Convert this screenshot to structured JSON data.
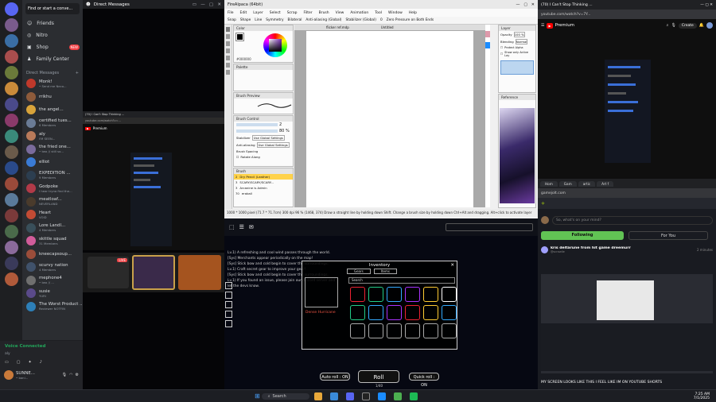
{
  "discord": {
    "search": "Find or start a conve...",
    "nav": [
      {
        "label": "Friends",
        "icon": "friends-icon"
      },
      {
        "label": "Nitro",
        "icon": "nitro-icon"
      },
      {
        "label": "Shop",
        "icon": "shop-icon",
        "badge": "NEW"
      },
      {
        "label": "Family Center",
        "icon": "family-icon"
      }
    ],
    "dm_header": "Direct Messages",
    "dm_add": "+",
    "dms": [
      {
        "name": "Monk!",
        "sub": "• Send me Neco...",
        "color": "#c0392b"
      },
      {
        "name": "rrikhu",
        "sub": "",
        "color": "#8e5b3b"
      },
      {
        "name": "the angel...",
        "sub": "",
        "color": "#d8a33a"
      },
      {
        "name": "certified tues...",
        "sub": "6 Members",
        "color": "#6a7b95"
      },
      {
        "name": "aly",
        "sub": "I'M SEEN...",
        "color": "#b97a5a"
      },
      {
        "name": "the fried one...",
        "sub": "• two // still so...",
        "color": "#7a6b9c"
      },
      {
        "name": "elliot",
        "sub": "",
        "color": "#3a7bd5"
      },
      {
        "name": "EXPEDITION ...",
        "sub": "9 Members",
        "color": "#2c3e50"
      },
      {
        "name": "Godpoke",
        "sub": "I hear tryna find the...",
        "color": "#b23a48"
      },
      {
        "name": "meatloaf...",
        "sub": "NEVERLAND",
        "color": "#4a3b2c"
      },
      {
        "name": "Heart",
        "sub": "VOID",
        "color": "#c24b34"
      },
      {
        "name": "Lore LandI...",
        "sub": "4 Members",
        "color": "#394f5a"
      },
      {
        "name": "skittle squad",
        "sub": "31 Members",
        "color": "#d15c9a"
      },
      {
        "name": "kneecapsoup...",
        "sub": "",
        "color": "#9b4d3a"
      },
      {
        "name": "scurvy nation",
        "sub": "4 Members",
        "color": "#40526b"
      },
      {
        "name": "mephone4",
        "sub": "• two // ...",
        "color": "#6f6f6f"
      },
      {
        "name": "susie",
        "sub": "YURI",
        "color": "#5a4a8a"
      },
      {
        "name": "The Worst Product ...",
        "sub": "Reviewer NOTFIN",
        "color": "#2d7fb8"
      }
    ],
    "voice": {
      "status": "Voice Connected",
      "channel": "aly",
      "user": "SUNNE...",
      "user_sub": "• bani..."
    },
    "main_title": "Direct Messages",
    "stream_tab": "(70) I Can't Stop Thinking ...",
    "stream_url": "youtube.com/watch?v=...",
    "live": "LIVE"
  },
  "firealpaca": {
    "title": "FireAlpaca (64bit)",
    "menu": [
      "File",
      "Edit",
      "Layer",
      "Select",
      "Scrap",
      "Filter",
      "Brush",
      "View",
      "Animation",
      "Tool",
      "Window",
      "Help"
    ],
    "toolbar": [
      "Snap",
      "Shape",
      "Line",
      "Symmetry",
      "Bilateral",
      "Anti-aliasing (Global)",
      "Stabilizer (Global)",
      "0",
      "Zero Pressure on Both Ends"
    ],
    "color_panel": "Color",
    "color_hex": "#000000",
    "palette": "Palette",
    "brush_preview": "Brush Preview",
    "brush_control": "Brush Control",
    "size": "2",
    "opacity": "80 %",
    "stabilizer_label": "Stabilizer",
    "stabilizer_val": "Use Global Settings",
    "aa_label": "Anti-aliasing",
    "aa_val": "Use Global Settings",
    "spacing_label": "Brush Spacing",
    "rotate": "Rotate Along",
    "brush_panel": "Brush",
    "brushes": [
      {
        "n": "2",
        "name": "Dry Pencil (Leather)"
      },
      {
        "n": "3",
        "name": "SCARY/SCARY/SCARY..."
      },
      {
        "n": "3",
        "name": "Arcanine is Admin"
      },
      {
        "n": "70",
        "name": "eraball"
      }
    ],
    "doc_title": "flicker ref.mdp",
    "doc2": "Untitled",
    "layer_panel": "Layer",
    "opacity_label": "Opacity",
    "opacity_val": "100 %",
    "blending": "Blending",
    "blending_val": "Normal",
    "protect": "Protect Alpha",
    "show_active": "Show only Active Lay",
    "reference": "Reference",
    "status": "1000 * 1000 pixel  (71.7 * 71.7cm)  300 dpi  96 %  (1468, 374)  Draw a straight line by holding down Shift. Change a brush size by holding down Ctrl+Alt and dragging. Alt+click to activate layer"
  },
  "roblox": {
    "chat": [
      "Lv.1) A refreshing and cool wind passes through the world.",
      "[Sys] Merchants appear periodically on the map!",
      "[Sys] Stick bow and cold begin to cover the surroundings.",
      "Lv.1) Craft secret gear to improve your gear!",
      "[Sys] Stick bow and cold begin to cover the surroundings.",
      "Lv.1) If you found an issue, please join our discord server and",
      "let the devs know."
    ],
    "inventory_title": "Inventory",
    "tab1": "Gears",
    "tab2": "Items",
    "search": "Search",
    "item_desc": "Dense Hurricane",
    "roll": "Roll",
    "auto_roll": "Auto roll : ON",
    "quick_roll": "Quick roll : ON",
    "count": "1/40"
  },
  "youtube": {
    "tab": "(70) I Can't Stop Thinking ...",
    "url": "youtube.com/watch?v=7Y...",
    "brand": "Premium",
    "create": "Create"
  },
  "gamejolt": {
    "tabs": [
      "Hom",
      "Gam",
      "artic",
      "Art f"
    ],
    "url": "gamejolt.com",
    "prompt": "So, what's on your mind?",
    "following": "Following",
    "for_you": "For You",
    "post_author": "kris deltarune from hit game dreemurr",
    "post_handle": "@scrawlie",
    "post_time": "2 minutes",
    "caption": "MY SCREEN LOOKS LIKE THIS I FEEL LIKE IM ON YOUTUBE SHORTS"
  },
  "taskbar": {
    "search": "Search",
    "time": "7:25 AM",
    "date": "7/1/2025"
  }
}
